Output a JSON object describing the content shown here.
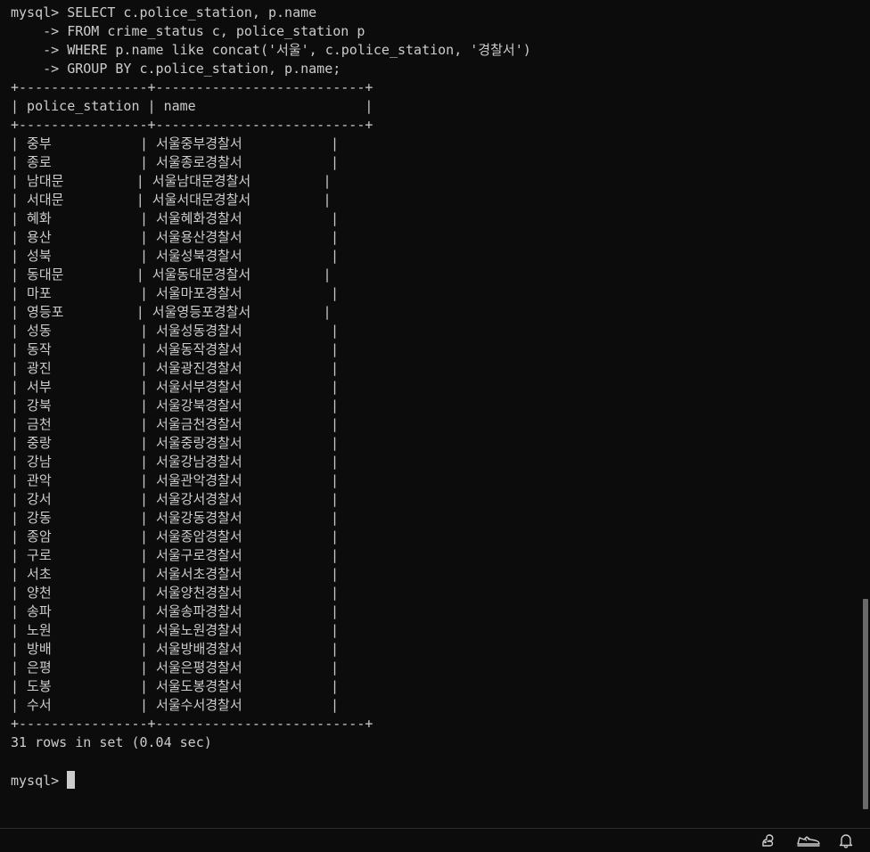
{
  "terminal": {
    "query_lines": [
      "mysql> SELECT c.police_station, p.name",
      "    -> FROM crime_status c, police_station p",
      "    -> WHERE p.name like concat('서울', c.police_station, '경찰서')",
      "    -> GROUP BY c.police_station, p.name;"
    ],
    "table": {
      "border": "+----------------+--------------------------+",
      "header": "| police_station | name                     |",
      "rows": [
        "| 중부           | 서울중부경찰서           |",
        "| 종로           | 서울종로경찰서           |",
        "| 남대문         | 서울남대문경찰서         |",
        "| 서대문         | 서울서대문경찰서         |",
        "| 혜화           | 서울혜화경찰서           |",
        "| 용산           | 서울용산경찰서           |",
        "| 성북           | 서울성북경찰서           |",
        "| 동대문         | 서울동대문경찰서         |",
        "| 마포           | 서울마포경찰서           |",
        "| 영등포         | 서울영등포경찰서         |",
        "| 성동           | 서울성동경찰서           |",
        "| 동작           | 서울동작경찰서           |",
        "| 광진           | 서울광진경찰서           |",
        "| 서부           | 서울서부경찰서           |",
        "| 강북           | 서울강북경찰서           |",
        "| 금천           | 서울금천경찰서           |",
        "| 중랑           | 서울중랑경찰서           |",
        "| 강남           | 서울강남경찰서           |",
        "| 관악           | 서울관악경찰서           |",
        "| 강서           | 서울강서경찰서           |",
        "| 강동           | 서울강동경찰서           |",
        "| 종암           | 서울종암경찰서           |",
        "| 구로           | 서울구로경찰서           |",
        "| 서초           | 서울서초경찰서           |",
        "| 양천           | 서울양천경찰서           |",
        "| 송파           | 서울송파경찰서           |",
        "| 노원           | 서울노원경찰서           |",
        "| 방배           | 서울방배경찰서           |",
        "| 은평           | 서울은평경찰서           |",
        "| 도봉           | 서울도봉경찰서           |",
        "| 수서           | 서울수서경찰서           |"
      ]
    },
    "result_summary": "31 rows in set (0.04 sec)",
    "prompt": "mysql> "
  },
  "statusbar": {
    "icons": [
      "squirrel-icon",
      "sneaker-icon",
      "bell-icon"
    ]
  },
  "colors": {
    "background": "#0c0c0c",
    "foreground": "#cccccc"
  }
}
